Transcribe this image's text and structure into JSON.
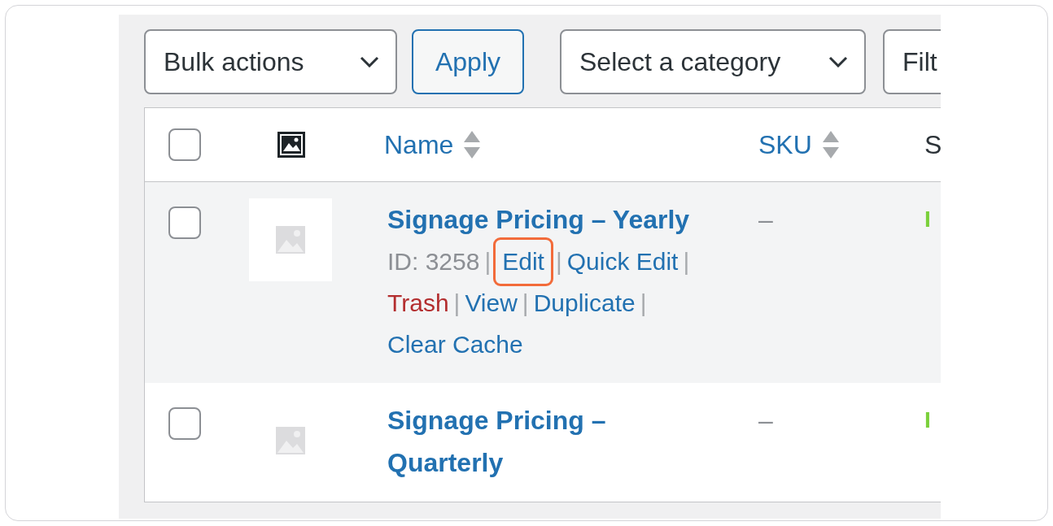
{
  "toolbar": {
    "bulk_actions": {
      "value": "Bulk actions"
    },
    "apply_button": "Apply",
    "category_filter": {
      "value": "Select a category"
    },
    "filter_button": "Filt"
  },
  "table": {
    "columns": [
      {
        "kind": "checkbox",
        "checked": false
      },
      {
        "kind": "image"
      },
      {
        "kind": "sortable",
        "label": "Name"
      },
      {
        "kind": "sortable",
        "label": "SKU"
      },
      {
        "kind": "text",
        "label": "S"
      }
    ],
    "rows": [
      {
        "checked": false,
        "hovered": true,
        "name": "Signage Pricing – Yearly",
        "sku": "–",
        "stock": "I",
        "actions": [
          {
            "kind": "id",
            "text": "ID: 3258",
            "separator": "|",
            "highlighted": false
          },
          {
            "kind": "link",
            "text": "Edit",
            "separator": "|",
            "highlighted": true
          },
          {
            "kind": "link",
            "text": "Quick Edit",
            "separator": "|",
            "highlighted": false
          },
          {
            "kind": "danger",
            "text": "Trash",
            "separator": "|",
            "highlighted": false
          },
          {
            "kind": "link",
            "text": "View",
            "separator": "|",
            "highlighted": false
          },
          {
            "kind": "link",
            "text": "Duplicate",
            "separator": "|",
            "highlighted": false
          },
          {
            "kind": "link",
            "text": "Clear Cache",
            "highlighted": false
          }
        ]
      },
      {
        "checked": false,
        "hovered": false,
        "name": "Signage Pricing – Quarterly",
        "sku": "–",
        "stock": "I"
      }
    ]
  }
}
